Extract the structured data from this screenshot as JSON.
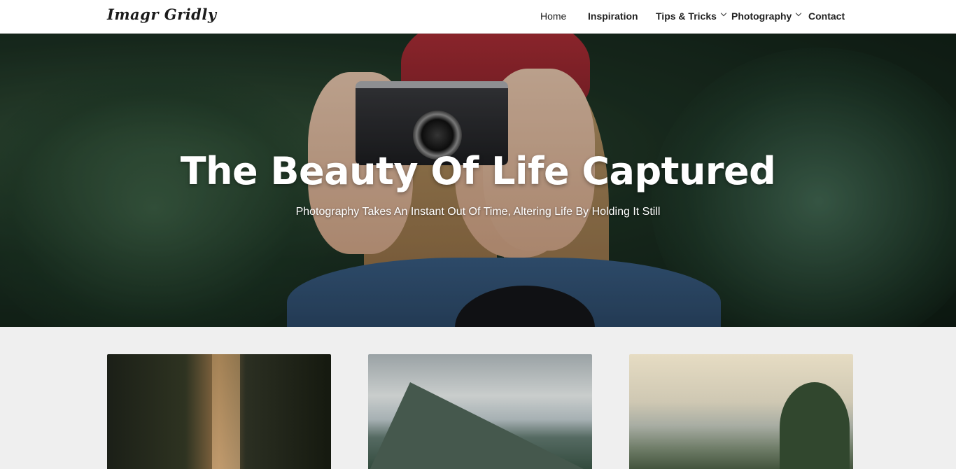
{
  "header": {
    "logo": "Imagr Gridly",
    "nav": [
      {
        "label": "Home",
        "dropdown": false
      },
      {
        "label": "Inspiration",
        "dropdown": false
      },
      {
        "label": "Tips & Tricks",
        "dropdown": true
      },
      {
        "label": "Photography",
        "dropdown": true
      },
      {
        "label": "Contact",
        "dropdown": false
      }
    ]
  },
  "hero": {
    "title": "The Beauty Of Life Captured",
    "subtitle": "Photography Takes An Instant Out Of Time, Altering Life By Holding It Still"
  },
  "cards": [
    {
      "image": "forest-light-rays"
    },
    {
      "image": "mountain-clouds"
    },
    {
      "image": "lake-trees-sky"
    }
  ]
}
